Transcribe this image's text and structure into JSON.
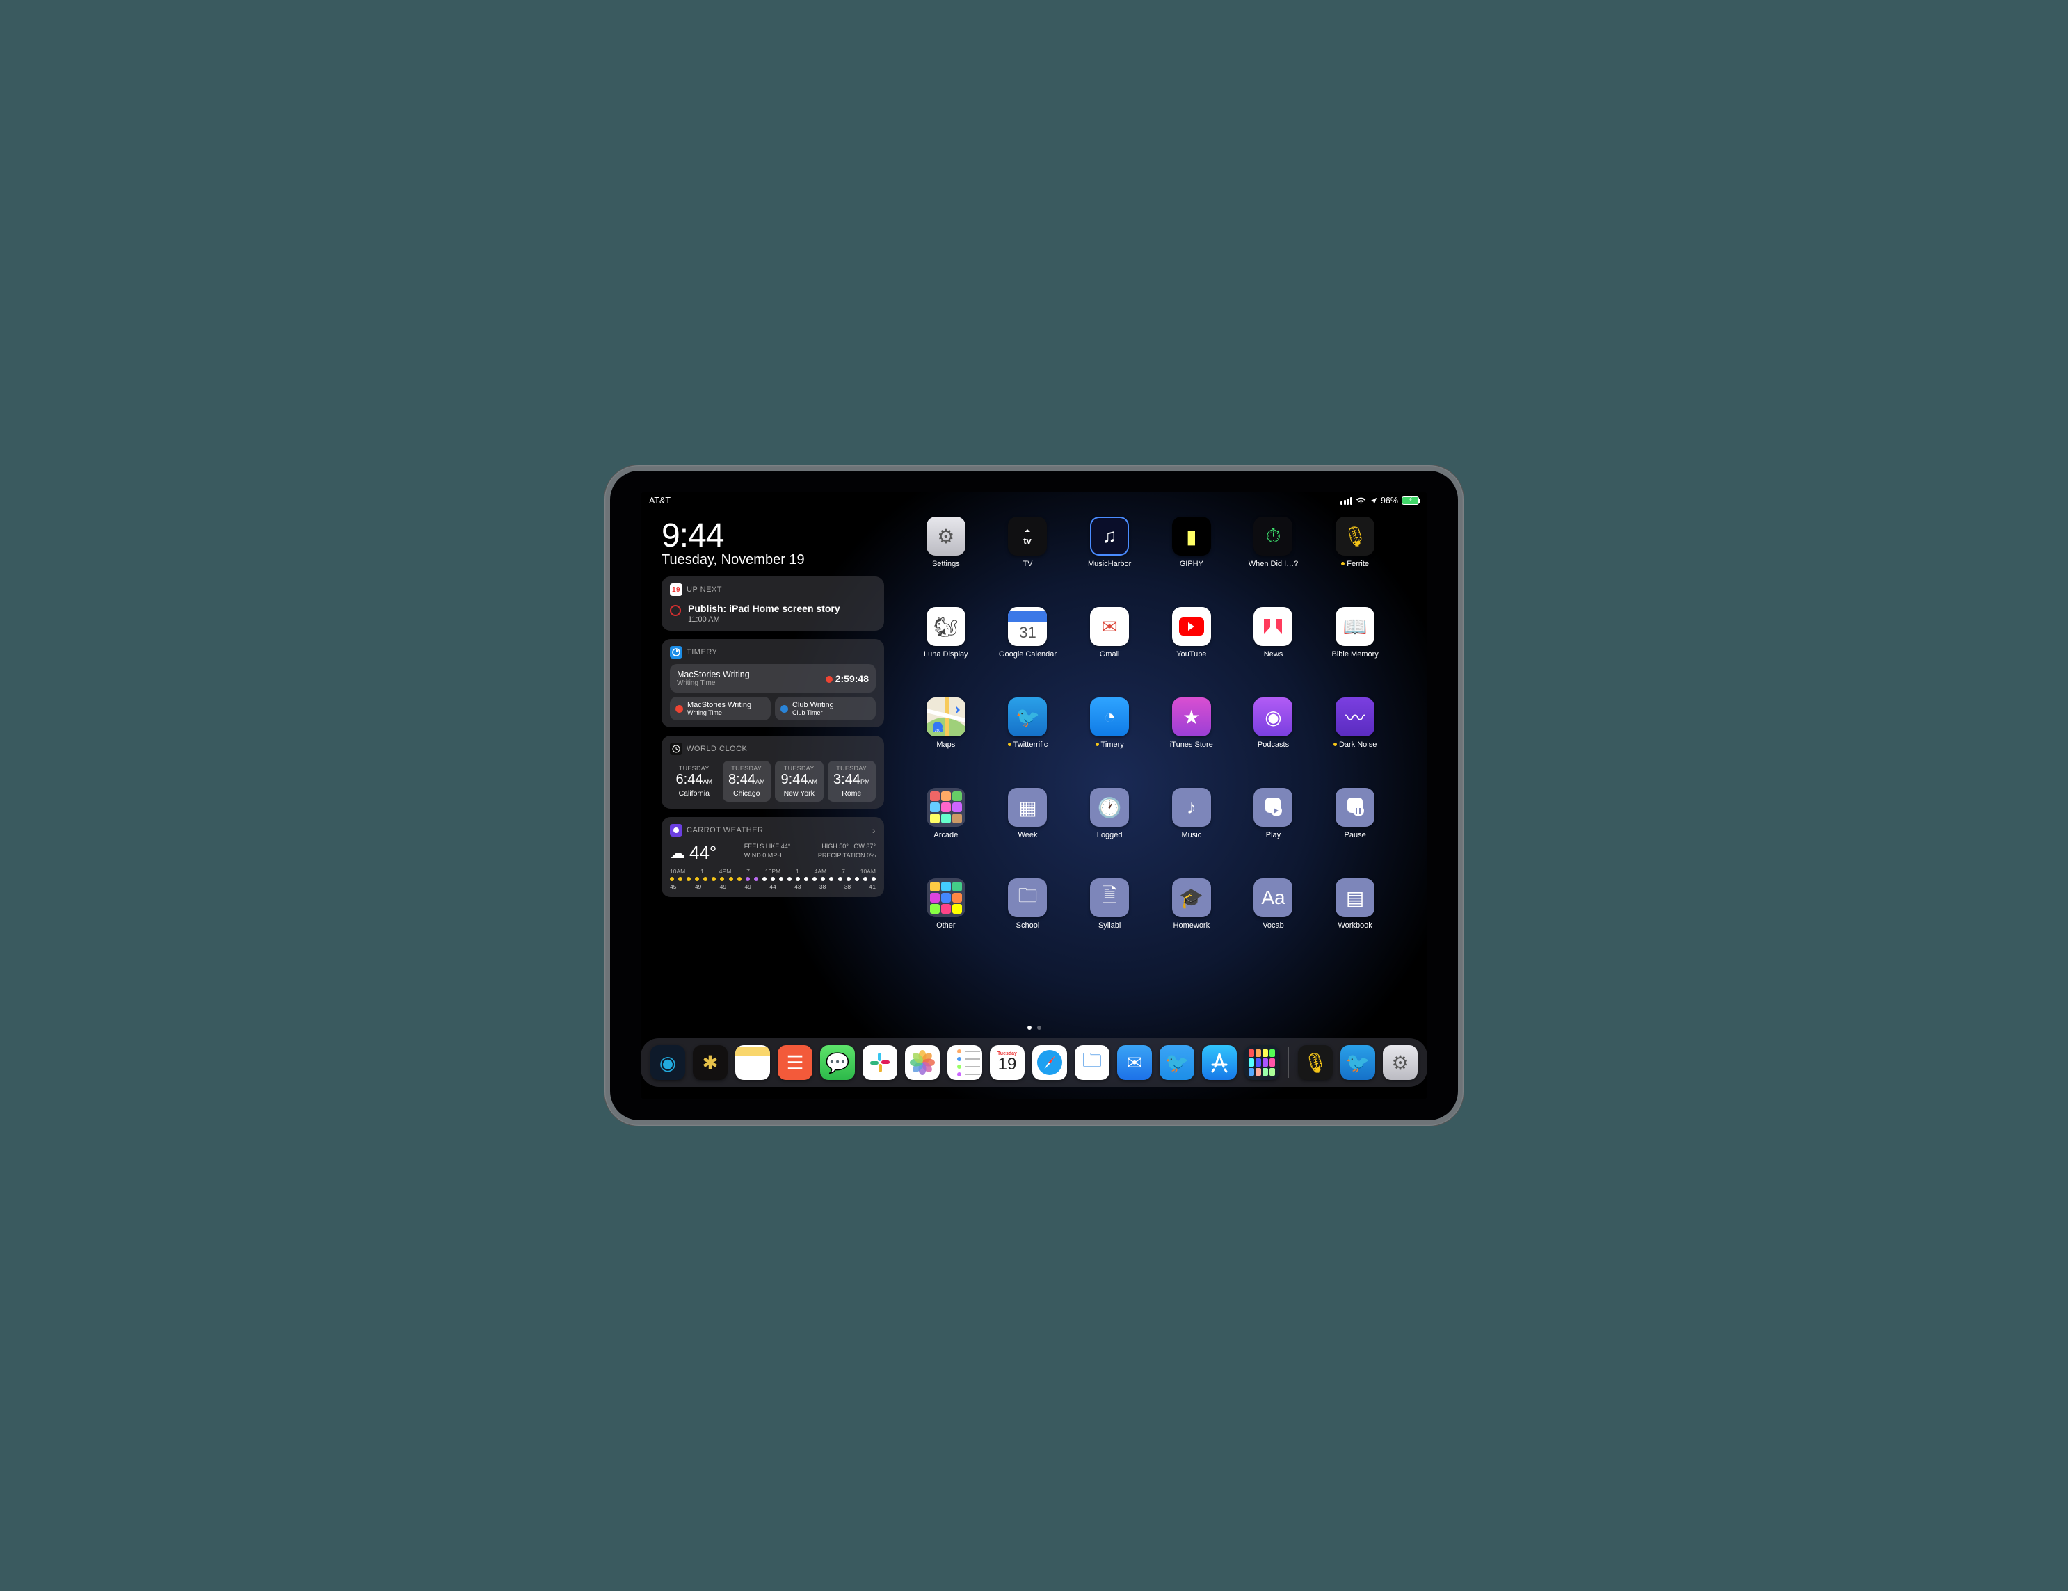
{
  "status": {
    "carrier": "AT&T",
    "battery_pct": "96%"
  },
  "clock": {
    "time": "9:44",
    "date": "Tuesday, November 19"
  },
  "widgets": {
    "upnext": {
      "badge": "19",
      "header": "UP NEXT",
      "event_title": "Publish: iPad Home screen story",
      "event_time": "11:00 AM"
    },
    "timery": {
      "header": "TIMERY",
      "running": {
        "name": "MacStories Writing",
        "sub": "Writing Time",
        "elapsed": "2:59:48"
      },
      "shortcuts": [
        {
          "name": "MacStories Writing",
          "sub": "Writing Time",
          "color": "r"
        },
        {
          "name": "Club Writing",
          "sub": "Club Timer",
          "color": "b"
        }
      ]
    },
    "worldclock": {
      "header": "WORLD CLOCK",
      "cities": [
        {
          "day": "TUESDAY",
          "time": "6:44",
          "ap": "AM",
          "city": "California",
          "dim": false
        },
        {
          "day": "TUESDAY",
          "time": "8:44",
          "ap": "AM",
          "city": "Chicago",
          "dim": true
        },
        {
          "day": "TUESDAY",
          "time": "9:44",
          "ap": "AM",
          "city": "New York",
          "dim": true
        },
        {
          "day": "TUESDAY",
          "time": "3:44",
          "ap": "PM",
          "city": "Rome",
          "dim": true
        }
      ]
    },
    "weather": {
      "header": "CARROT WEATHER",
      "temp": "44°",
      "feels": "FEELS LIKE 44°",
      "wind": "WIND 0 MPH",
      "high": "HIGH 50° LOW 37°",
      "precip": "PRECIPITATION 0%",
      "hours": [
        "10AM",
        "1",
        "4PM",
        "7",
        "10PM",
        "1",
        "4AM",
        "7",
        "10AM"
      ],
      "hour_temps": [
        "45",
        "49",
        "49",
        "49",
        "44",
        "43",
        "38",
        "38",
        "41"
      ]
    }
  },
  "apps": {
    "rows": [
      [
        {
          "label": "Settings",
          "bg": "linear-gradient(#e7e7ec,#bbbbc2)",
          "glyph": "⚙︎",
          "fg": "#555"
        },
        {
          "label": "TV",
          "bg": "#101012",
          "glyph": "tv",
          "fg": "#fff"
        },
        {
          "label": "MusicHarbor",
          "bg": "#0a0e2a",
          "glyph": "♫",
          "fg": "#fff",
          "border": "#4a8cff"
        },
        {
          "label": "GIPHY",
          "bg": "#000",
          "glyph": "▮",
          "fg": "#ff6"
        },
        {
          "label": "When Did I…?",
          "bg": "#0c0c10",
          "glyph": "⏱",
          "fg": "#3ddc6c"
        },
        {
          "label": "Ferrite",
          "bg": "#171717",
          "glyph": "🎙",
          "fg": "#f5c518",
          "dot": true
        }
      ],
      [
        {
          "label": "Luna Display",
          "bg": "#fff",
          "glyph": "🐿",
          "fg": "#444"
        },
        {
          "label": "Google Calendar",
          "bg": "#fff",
          "glyph": "31",
          "fg": "#3b78e7",
          "cal": true
        },
        {
          "label": "Gmail",
          "bg": "#fff",
          "glyph": "✉︎",
          "fg": "#db4437"
        },
        {
          "label": "YouTube",
          "bg": "#fff",
          "glyph": "▶",
          "fg": "#f00",
          "yt": true
        },
        {
          "label": "News",
          "bg": "#fff",
          "glyph": "N",
          "fg": "#f33",
          "news": true
        },
        {
          "label": "Bible Memory",
          "bg": "#fff",
          "glyph": "📖",
          "fg": "#d33"
        }
      ],
      [
        {
          "label": "Maps",
          "bg": "#f6f4ef",
          "glyph": "🗺",
          "fg": "#333",
          "maps": true
        },
        {
          "label": "Twitterrific",
          "bg": "linear-gradient(#2aa0e8,#1571c9)",
          "glyph": "🐦",
          "fg": "#fff",
          "dot": true
        },
        {
          "label": "Timery",
          "bg": "linear-gradient(#2fa4ff,#0f7be6)",
          "glyph": "◔",
          "fg": "#fff",
          "dot": true
        },
        {
          "label": "iTunes Store",
          "bg": "linear-gradient(#d94fd1,#9b3fd6)",
          "glyph": "★",
          "fg": "#fff"
        },
        {
          "label": "Podcasts",
          "bg": "linear-gradient(#b25cf5,#7a3fe0)",
          "glyph": "◉",
          "fg": "#fff"
        },
        {
          "label": "Dark Noise",
          "bg": "linear-gradient(#7b3fe0,#5a2cc0)",
          "glyph": "〰",
          "fg": "#fff",
          "dot": true
        }
      ],
      [
        {
          "label": "Arcade",
          "folder": true,
          "colors": [
            "#e66",
            "#fa6",
            "#6c6",
            "#6cf",
            "#f6c",
            "#c6f",
            "#ff6",
            "#6fc",
            "#c96"
          ]
        },
        {
          "label": "Week",
          "bg": "#7d86ba",
          "glyph": "▦",
          "fg": "#fff"
        },
        {
          "label": "Logged",
          "bg": "#7d86ba",
          "glyph": "🕐",
          "fg": "#fff"
        },
        {
          "label": "Music",
          "bg": "#7d86ba",
          "glyph": "♪",
          "fg": "#fff"
        },
        {
          "label": "Play",
          "bg": "#7d86ba",
          "glyph": "▣",
          "fg": "#fff",
          "home": "play"
        },
        {
          "label": "Pause",
          "bg": "#7d86ba",
          "glyph": "▣",
          "fg": "#fff",
          "home": "pause"
        }
      ],
      [
        {
          "label": "Other",
          "folder": true,
          "colors": [
            "#fc4",
            "#4cf",
            "#4c8",
            "#d4d",
            "#48f",
            "#f84",
            "#8f4",
            "#f48",
            "#ff0"
          ]
        },
        {
          "label": "School",
          "bg": "#7d86ba",
          "glyph": "🗀",
          "fg": "#fff"
        },
        {
          "label": "Syllabi",
          "bg": "#7d86ba",
          "glyph": "🗎",
          "fg": "#fff"
        },
        {
          "label": "Homework",
          "bg": "#7d86ba",
          "glyph": "🎓",
          "fg": "#fff"
        },
        {
          "label": "Vocab",
          "bg": "#7d86ba",
          "glyph": "Aa",
          "fg": "#fff"
        },
        {
          "label": "Workbook",
          "bg": "#7d86ba",
          "glyph": "▤",
          "fg": "#fff"
        }
      ]
    ]
  },
  "dock": [
    {
      "name": "touchid",
      "bg": "#0e1a2a",
      "glyph": "◉",
      "fg": "#2ad"
    },
    {
      "name": "drafts",
      "bg": "#121010",
      "glyph": "✱",
      "fg": "#e6c14a"
    },
    {
      "name": "notes",
      "bg": "#fff",
      "glyph": "☰",
      "fg": "#777",
      "notes": true
    },
    {
      "name": "agenda",
      "bg": "#f35a3a",
      "glyph": "☰",
      "fg": "#fff"
    },
    {
      "name": "messages",
      "bg": "linear-gradient(#5de36a,#2db94a)",
      "glyph": "💬",
      "fg": "#fff"
    },
    {
      "name": "slack",
      "bg": "#fff",
      "glyph": "✱",
      "fg": "#611f69",
      "slack": true
    },
    {
      "name": "photos",
      "bg": "#fff",
      "glyph": "✿",
      "fg": "#f66",
      "photos": true
    },
    {
      "name": "reminders",
      "bg": "#fff",
      "glyph": "⋮",
      "fg": "#666",
      "rem": true
    },
    {
      "name": "calendar",
      "bg": "#fff",
      "glyph": "19",
      "fg": "#222",
      "cal": true,
      "day": "Tuesday"
    },
    {
      "name": "safari",
      "bg": "#fff",
      "glyph": "◎",
      "fg": "#1e7ee0",
      "safari": true
    },
    {
      "name": "files",
      "bg": "#fff",
      "glyph": "🗀",
      "fg": "#1e7ee0"
    },
    {
      "name": "mail",
      "bg": "linear-gradient(#3aa4f5,#1d72e8)",
      "glyph": "✉︎",
      "fg": "#fff"
    },
    {
      "name": "twitter",
      "bg": "linear-gradient(#3aa4f5,#1d8ee8)",
      "glyph": "🐦",
      "fg": "#fff"
    },
    {
      "name": "appstore",
      "bg": "linear-gradient(#31c4fc,#1779e8)",
      "glyph": "A",
      "fg": "#fff",
      "astore": true
    },
    {
      "name": "shortcuts",
      "bg": "#16202c",
      "glyph": "⊞",
      "fg": "#ff8",
      "grid": true
    }
  ],
  "dock_recent": [
    {
      "name": "ferrite",
      "bg": "#171717",
      "glyph": "🎙",
      "fg": "#f5c518"
    },
    {
      "name": "twitterrific",
      "bg": "linear-gradient(#2aa0e8,#1571c9)",
      "glyph": "🐦",
      "fg": "#fff"
    },
    {
      "name": "settings",
      "bg": "linear-gradient(#e7e7ec,#bbbbc2)",
      "glyph": "⚙︎",
      "fg": "#555"
    }
  ]
}
